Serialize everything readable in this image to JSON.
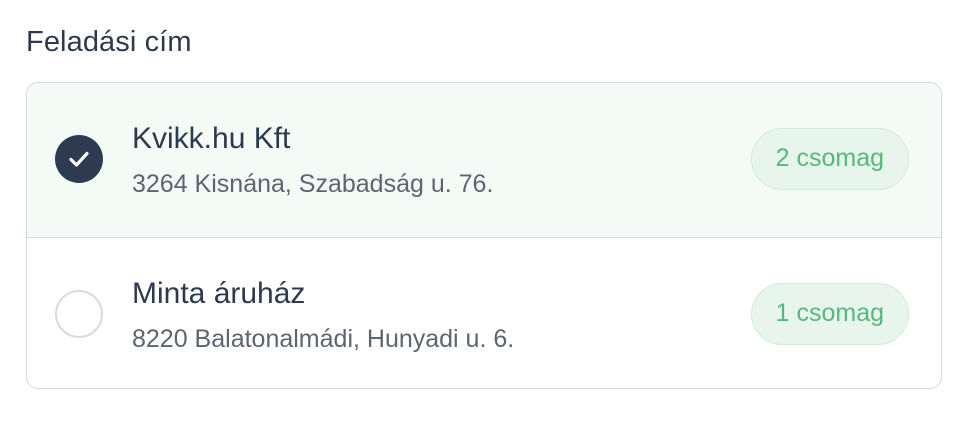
{
  "section": {
    "title": "Feladási cím"
  },
  "addresses": [
    {
      "name": "Kvikk.hu Kft",
      "address": "3264 Kisnána, Szabadság u. 76.",
      "badge": "2 csomag",
      "selected": true
    },
    {
      "name": "Minta áruház",
      "address": "8220 Balatonalmádi, Hunyadi u. 6.",
      "badge": "1 csomag",
      "selected": false
    }
  ],
  "colors": {
    "selected_background": "#f4faf6",
    "radio_checked": "#2e3a4f",
    "badge_text": "#55b97c",
    "badge_background": "#e8f5ec"
  }
}
